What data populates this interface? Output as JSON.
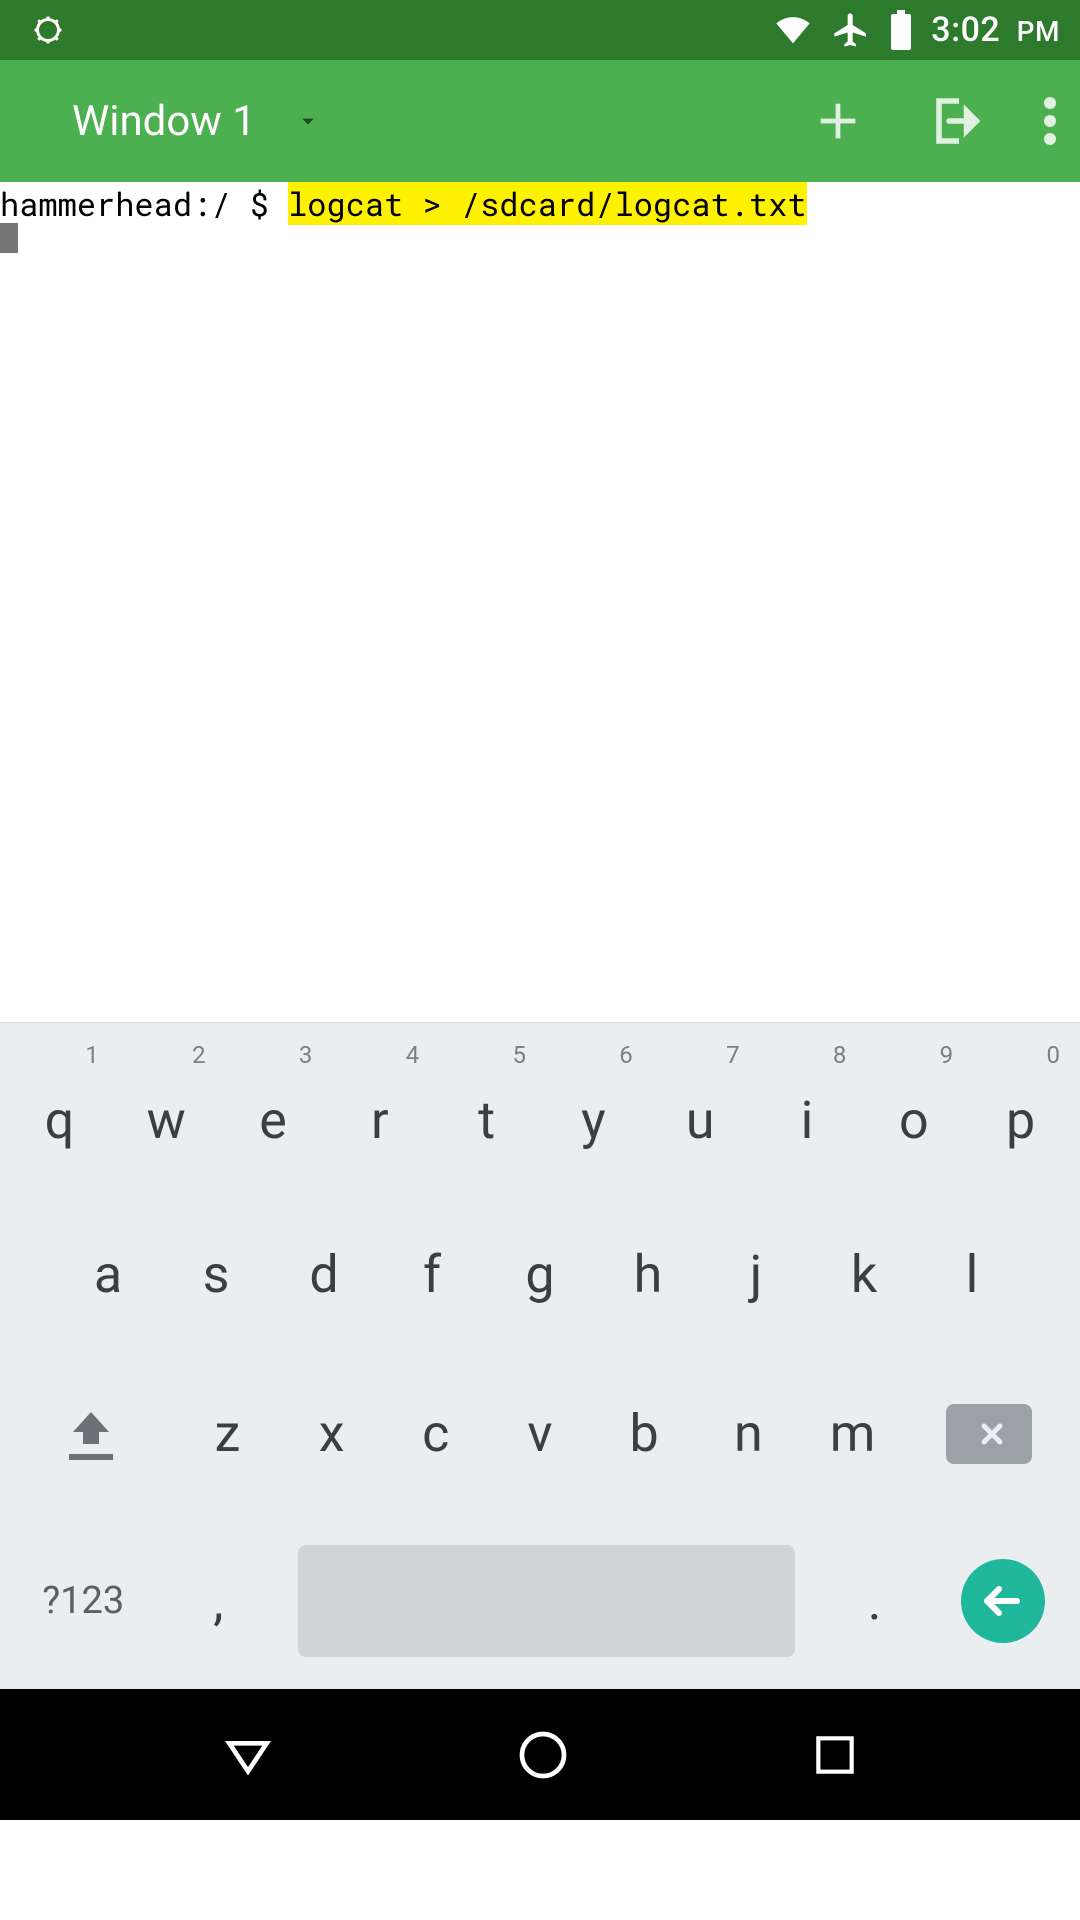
{
  "status": {
    "time": "3:02",
    "ampm": "PM",
    "icons": {
      "debug": "debug-icon",
      "wifi": "wifi-icon",
      "airplane": "airplane-icon",
      "battery": "battery-icon"
    }
  },
  "appbar": {
    "window_label": "Window 1",
    "actions": {
      "add": "plus-icon",
      "export": "export-icon",
      "menu": "more-icon"
    }
  },
  "terminal": {
    "prompt": "hammerhead:/ $ ",
    "command": "logcat > /sdcard/logcat.txt"
  },
  "keyboard": {
    "row1": [
      {
        "main": "q",
        "hint": "1"
      },
      {
        "main": "w",
        "hint": "2"
      },
      {
        "main": "e",
        "hint": "3"
      },
      {
        "main": "r",
        "hint": "4"
      },
      {
        "main": "t",
        "hint": "5"
      },
      {
        "main": "y",
        "hint": "6"
      },
      {
        "main": "u",
        "hint": "7"
      },
      {
        "main": "i",
        "hint": "8"
      },
      {
        "main": "o",
        "hint": "9"
      },
      {
        "main": "p",
        "hint": "0"
      }
    ],
    "row2": [
      "a",
      "s",
      "d",
      "f",
      "g",
      "h",
      "j",
      "k",
      "l"
    ],
    "row3": [
      "z",
      "x",
      "c",
      "v",
      "b",
      "n",
      "m"
    ],
    "sym_label": "?123",
    "comma": ",",
    "dot": "."
  },
  "navbar": {
    "back": "back-icon",
    "home": "home-icon",
    "recent": "recent-icon"
  }
}
